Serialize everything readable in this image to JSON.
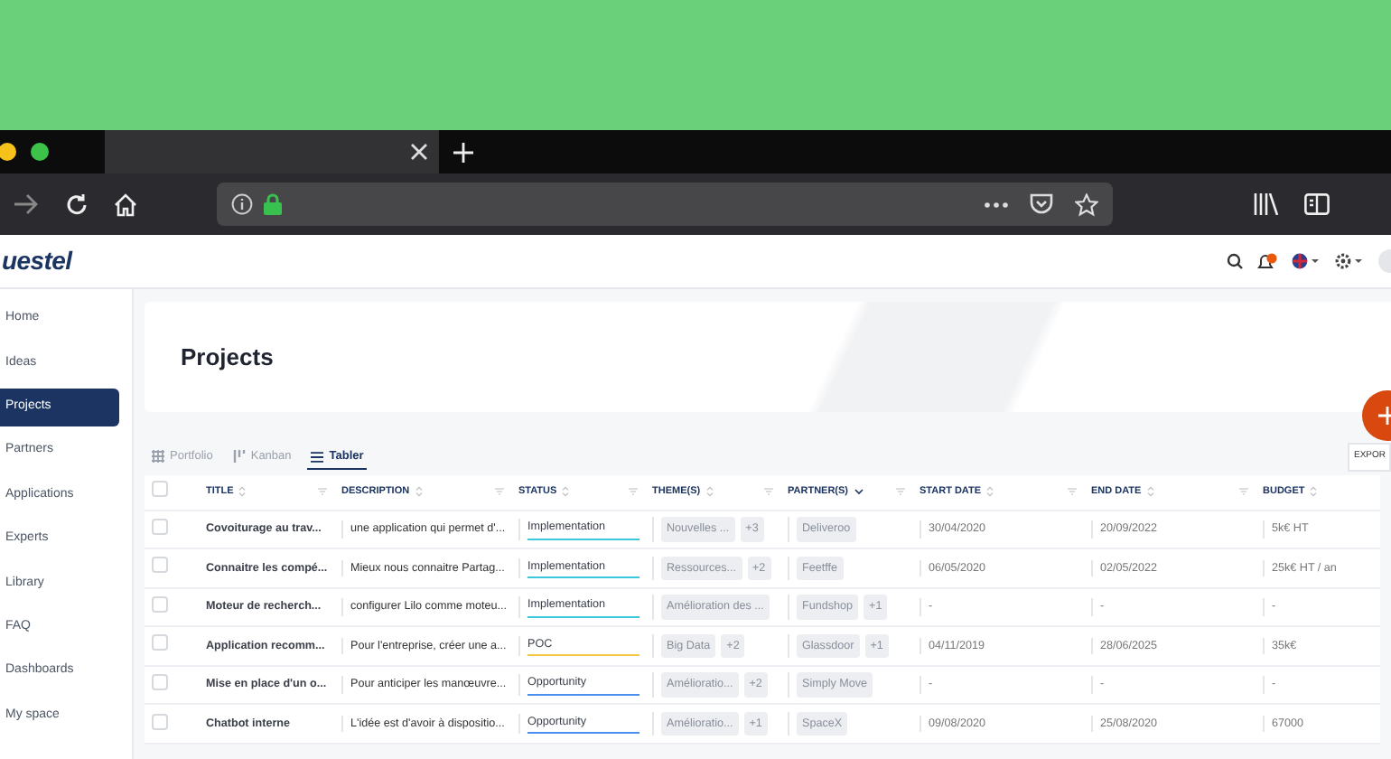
{
  "app_header": {
    "logo": "uestel"
  },
  "sidebar": {
    "items": [
      {
        "label": "Home",
        "selected": false
      },
      {
        "label": "Ideas",
        "selected": false
      },
      {
        "label": "Projects",
        "selected": true
      },
      {
        "label": "Partners",
        "selected": false
      },
      {
        "label": "Applications",
        "selected": false
      },
      {
        "label": "Experts",
        "selected": false
      },
      {
        "label": "Library",
        "selected": false
      },
      {
        "label": "FAQ",
        "selected": false
      },
      {
        "label": "Dashboards",
        "selected": false
      },
      {
        "label": "My space",
        "selected": false
      }
    ]
  },
  "page_title": "Projects",
  "view_tabs": [
    {
      "label": "Portfolio",
      "kind": "grid",
      "selected": false
    },
    {
      "label": "Kanban",
      "kind": "kanban",
      "selected": false
    },
    {
      "label": "Tabler",
      "kind": "list",
      "selected": true
    }
  ],
  "export_button": "EXPOR",
  "table": {
    "header_checked": false,
    "columns": [
      {
        "label": "TITLE",
        "sorted": false
      },
      {
        "label": "DESCRIPTION",
        "sorted": false
      },
      {
        "label": "STATUS",
        "sorted": false
      },
      {
        "label": "THEME(S)",
        "sorted": false
      },
      {
        "label": "PARTNER(S)",
        "sorted": true
      },
      {
        "label": "START DATE",
        "sorted": false
      },
      {
        "label": "END DATE",
        "sorted": false
      },
      {
        "label": "BUDGET",
        "sorted": false
      }
    ],
    "rows": [
      {
        "checked": false,
        "title": "Covoiturage au trav...",
        "description": "une application qui permet d'...",
        "status": {
          "label": "Implementation",
          "color": "#3cc8dc"
        },
        "themes": [
          "Nouvelles ...",
          "+3"
        ],
        "partners": [
          "Deliveroo"
        ],
        "start_date": "30/04/2020",
        "end_date": "20/09/2022",
        "budget": "5k€ HT"
      },
      {
        "checked": false,
        "title": "Connaitre les compé...",
        "description": "Mieux nous connaitre Partag...",
        "status": {
          "label": "Implementation",
          "color": "#3cc8dc"
        },
        "themes": [
          "Ressources...",
          "+2"
        ],
        "partners": [
          "Feetffe"
        ],
        "start_date": "06/05/2020",
        "end_date": "02/05/2022",
        "budget": "25k€ HT / an"
      },
      {
        "checked": false,
        "title": "Moteur de recherch...",
        "description": "configurer Lilo comme moteu...",
        "status": {
          "label": "Implementation",
          "color": "#3cc8dc"
        },
        "themes": [
          "Amélioration des ..."
        ],
        "partners": [
          "Fundshop",
          "+1"
        ],
        "start_date": "-",
        "end_date": "-",
        "budget": "-"
      },
      {
        "checked": false,
        "title": "Application recomm...",
        "description": "Pour l'entreprise, créer une a...",
        "status": {
          "label": "POC",
          "color": "#f7c948"
        },
        "themes": [
          "Big Data",
          "+2"
        ],
        "partners": [
          "Glassdoor",
          "+1"
        ],
        "start_date": "04/11/2019",
        "end_date": "28/06/2025",
        "budget": "35k€"
      },
      {
        "checked": false,
        "title": "Mise en place d'un o...",
        "description": "Pour anticiper les manœuvre...",
        "status": {
          "label": "Opportunity",
          "color": "#4a8ff0"
        },
        "themes": [
          "Amélioratio...",
          "+2"
        ],
        "partners": [
          "Simply Move"
        ],
        "start_date": "-",
        "end_date": "-",
        "budget": "-"
      },
      {
        "checked": false,
        "title": "Chatbot interne",
        "description": "L'idée est d'avoir à dispositio...",
        "status": {
          "label": "Opportunity",
          "color": "#4a8ff0"
        },
        "themes": [
          "Amélioratio...",
          "+1"
        ],
        "partners": [
          "SpaceX"
        ],
        "start_date": "09/08/2020",
        "end_date": "25/08/2020",
        "budget": "67000"
      }
    ]
  }
}
